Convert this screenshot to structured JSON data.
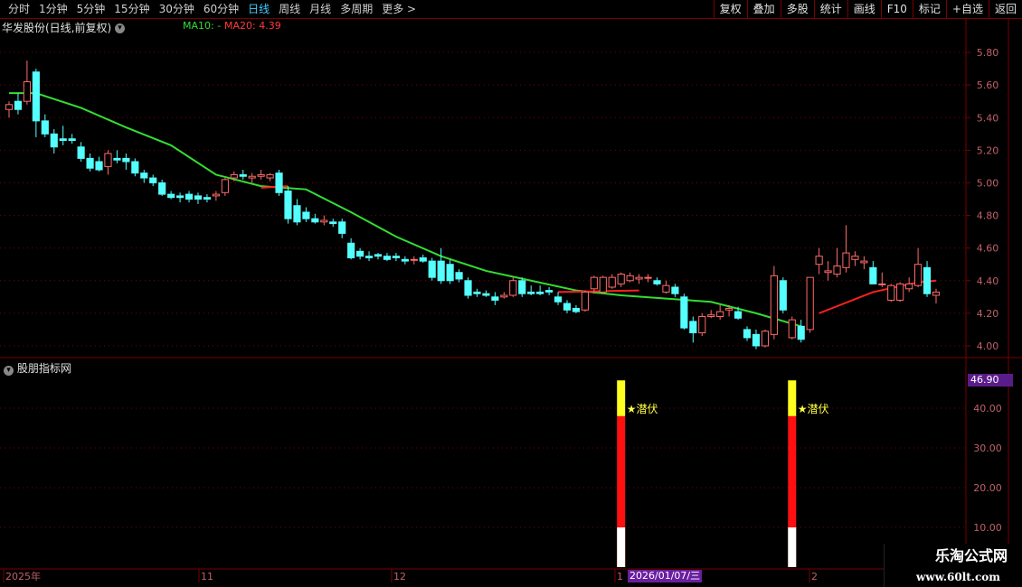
{
  "toolbar": {
    "periods": [
      "分时",
      "1分钟",
      "5分钟",
      "15分钟",
      "30分钟",
      "60分钟",
      "日线",
      "周线",
      "月线",
      "多周期",
      "更多 >"
    ],
    "active": "日线",
    "right_buttons": [
      "复权",
      "叠加",
      "多股",
      "统计",
      "画线",
      "F10",
      "标记",
      "+自选",
      "返回"
    ]
  },
  "chart_title": "华发股份(日线,前复权)",
  "ma_labels": {
    "ma10": "MA10: -",
    "ma20": "MA20: 4.39"
  },
  "price_axis": [
    "5.80",
    "5.60",
    "5.40",
    "5.20",
    "5.00",
    "4.80",
    "4.60",
    "4.40",
    "4.20",
    "4.00"
  ],
  "indicator_title": "股朋指标网",
  "indicator_axis": [
    "40.00",
    "30.00",
    "20.00",
    "10.00"
  ],
  "indicator_value": "46.90",
  "signal_label": "★潜伏",
  "time_axis": [
    "2025年",
    "11",
    "12",
    "1",
    "2"
  ],
  "cursor_date": "2026/01/07/三",
  "watermark": {
    "name": "乐淘公式网",
    "url": "www.60lt.com"
  },
  "colors": {
    "up": "#ff6a6a",
    "down": "#54ffff",
    "ma": "#33dd33",
    "ma_red": "#ff2020",
    "grid": "#7a0000"
  },
  "chart_data": {
    "type": "candlestick",
    "ylim": [
      3.95,
      5.9
    ],
    "candles": [
      [
        5.45,
        5.5,
        5.4,
        5.48
      ],
      [
        5.5,
        5.55,
        5.42,
        5.45
      ],
      [
        5.5,
        5.75,
        5.48,
        5.62
      ],
      [
        5.68,
        5.7,
        5.28,
        5.38
      ],
      [
        5.38,
        5.42,
        5.28,
        5.3
      ],
      [
        5.3,
        5.33,
        5.18,
        5.22
      ],
      [
        5.27,
        5.35,
        5.23,
        5.26
      ],
      [
        5.27,
        5.3,
        5.24,
        5.26
      ],
      [
        5.22,
        5.25,
        5.13,
        5.15
      ],
      [
        5.15,
        5.18,
        5.07,
        5.09
      ],
      [
        5.13,
        5.16,
        5.07,
        5.08
      ],
      [
        5.1,
        5.2,
        5.05,
        5.18
      ],
      [
        5.15,
        5.2,
        5.12,
        5.14
      ],
      [
        5.15,
        5.18,
        5.08,
        5.13
      ],
      [
        5.13,
        5.15,
        5.04,
        5.06
      ],
      [
        5.06,
        5.08,
        5.0,
        5.03
      ],
      [
        5.03,
        5.05,
        4.98,
        5.0
      ],
      [
        5.0,
        5.02,
        4.92,
        4.93
      ],
      [
        4.93,
        4.95,
        4.9,
        4.91
      ],
      [
        4.92,
        4.94,
        4.88,
        4.91
      ],
      [
        4.93,
        4.95,
        4.88,
        4.9
      ],
      [
        4.92,
        4.94,
        4.87,
        4.9
      ],
      [
        4.91,
        4.93,
        4.88,
        4.9
      ],
      [
        4.92,
        4.95,
        4.89,
        4.93
      ],
      [
        4.94,
        5.03,
        4.92,
        5.02
      ],
      [
        5.03,
        5.07,
        5.01,
        5.05
      ],
      [
        5.05,
        5.08,
        5.02,
        5.04
      ],
      [
        5.03,
        5.06,
        5.0,
        5.04
      ],
      [
        5.04,
        5.08,
        5.02,
        5.05
      ],
      [
        5.03,
        5.06,
        5.01,
        5.05
      ],
      [
        5.06,
        5.08,
        4.92,
        4.94
      ],
      [
        4.95,
        4.98,
        4.75,
        4.78
      ],
      [
        4.86,
        4.9,
        4.74,
        4.76
      ],
      [
        4.82,
        4.85,
        4.76,
        4.78
      ],
      [
        4.78,
        4.81,
        4.75,
        4.76
      ],
      [
        4.76,
        4.8,
        4.74,
        4.77
      ],
      [
        4.76,
        4.78,
        4.73,
        4.75
      ],
      [
        4.76,
        4.78,
        4.66,
        4.69
      ],
      [
        4.63,
        4.66,
        4.53,
        4.54
      ],
      [
        4.58,
        4.6,
        4.53,
        4.55
      ],
      [
        4.55,
        4.58,
        4.52,
        4.54
      ],
      [
        4.56,
        4.57,
        4.53,
        4.55
      ],
      [
        4.55,
        4.57,
        4.52,
        4.53
      ],
      [
        4.55,
        4.57,
        4.52,
        4.54
      ],
      [
        4.53,
        4.55,
        4.5,
        4.52
      ],
      [
        4.53,
        4.55,
        4.5,
        4.53
      ],
      [
        4.54,
        4.56,
        4.51,
        4.52
      ],
      [
        4.52,
        4.54,
        4.4,
        4.42
      ],
      [
        4.52,
        4.6,
        4.38,
        4.4
      ],
      [
        4.5,
        4.53,
        4.38,
        4.4
      ],
      [
        4.45,
        4.47,
        4.39,
        4.41
      ],
      [
        4.4,
        4.42,
        4.29,
        4.31
      ],
      [
        4.33,
        4.35,
        4.3,
        4.32
      ],
      [
        4.32,
        4.34,
        4.3,
        4.31
      ],
      [
        4.3,
        4.33,
        4.25,
        4.28
      ],
      [
        4.3,
        4.33,
        4.29,
        4.31
      ],
      [
        4.31,
        4.42,
        4.3,
        4.4
      ],
      [
        4.4,
        4.42,
        4.3,
        4.32
      ],
      [
        4.33,
        4.37,
        4.31,
        4.32
      ],
      [
        4.33,
        4.37,
        4.31,
        4.32
      ],
      [
        4.34,
        4.36,
        4.31,
        4.33
      ],
      [
        4.3,
        4.33,
        4.25,
        4.27
      ],
      [
        4.26,
        4.28,
        4.2,
        4.22
      ],
      [
        4.23,
        4.25,
        4.2,
        4.21
      ],
      [
        4.22,
        4.34,
        4.21,
        4.33
      ],
      [
        4.35,
        4.43,
        4.32,
        4.42
      ],
      [
        4.33,
        4.43,
        4.32,
        4.42
      ],
      [
        4.36,
        4.44,
        4.35,
        4.42
      ],
      [
        4.38,
        4.45,
        4.36,
        4.44
      ],
      [
        4.4,
        4.45,
        4.39,
        4.43
      ],
      [
        4.41,
        4.44,
        4.38,
        4.42
      ],
      [
        4.42,
        4.44,
        4.39,
        4.42
      ],
      [
        4.4,
        4.42,
        4.37,
        4.38
      ],
      [
        4.33,
        4.4,
        4.32,
        4.37
      ],
      [
        4.36,
        4.38,
        4.3,
        4.32
      ],
      [
        4.3,
        4.32,
        4.1,
        4.11
      ],
      [
        4.15,
        4.18,
        4.02,
        4.08
      ],
      [
        4.08,
        4.2,
        4.06,
        4.18
      ],
      [
        4.18,
        4.22,
        4.17,
        4.19
      ],
      [
        4.18,
        4.25,
        4.16,
        4.21
      ],
      [
        4.22,
        4.25,
        4.18,
        4.23
      ],
      [
        4.21,
        4.24,
        4.16,
        4.17
      ],
      [
        4.1,
        4.12,
        4.03,
        4.05
      ],
      [
        4.07,
        4.1,
        3.98,
        4.0
      ],
      [
        4.0,
        4.1,
        3.99,
        4.09
      ],
      [
        4.07,
        4.49,
        4.04,
        4.43
      ],
      [
        4.4,
        4.42,
        4.2,
        4.22
      ],
      [
        4.05,
        4.18,
        4.04,
        4.16
      ],
      [
        4.12,
        4.16,
        4.02,
        4.04
      ],
      [
        4.1,
        4.42,
        4.08,
        4.42
      ],
      [
        4.5,
        4.6,
        4.44,
        4.55
      ],
      [
        4.45,
        4.52,
        4.4,
        4.46
      ],
      [
        4.44,
        4.6,
        4.42,
        4.49
      ],
      [
        4.48,
        4.74,
        4.45,
        4.57
      ],
      [
        4.53,
        4.58,
        4.49,
        4.55
      ],
      [
        4.51,
        4.55,
        4.47,
        4.52
      ],
      [
        4.48,
        4.52,
        4.4,
        4.38
      ],
      [
        4.38,
        4.45,
        4.36,
        4.38
      ],
      [
        4.28,
        4.38,
        4.27,
        4.37
      ],
      [
        4.28,
        4.39,
        4.27,
        4.38
      ],
      [
        4.35,
        4.42,
        4.33,
        4.38
      ],
      [
        4.37,
        4.6,
        4.36,
        4.5
      ],
      [
        4.48,
        4.52,
        4.3,
        4.32
      ],
      [
        4.31,
        4.35,
        4.26,
        4.33
      ]
    ],
    "ma_green": [
      [
        0,
        5.55
      ],
      [
        3,
        5.55
      ],
      [
        8,
        5.46
      ],
      [
        13,
        5.34
      ],
      [
        18,
        5.23
      ],
      [
        23,
        5.05
      ],
      [
        28,
        4.98
      ],
      [
        33,
        4.96
      ],
      [
        38,
        4.82
      ],
      [
        43,
        4.67
      ],
      [
        48,
        4.55
      ],
      [
        53,
        4.46
      ],
      [
        58,
        4.4
      ],
      [
        63,
        4.34
      ],
      [
        68,
        4.31
      ],
      [
        73,
        4.29
      ],
      [
        78,
        4.27
      ],
      [
        83,
        4.2
      ],
      [
        88,
        4.12
      ]
    ],
    "ma_red_segments": [
      [
        [
          28,
          4.97
        ],
        [
          31,
          4.98
        ]
      ],
      [
        [
          61,
          4.33
        ],
        [
          70,
          4.34
        ]
      ],
      [
        [
          90,
          4.2
        ],
        [
          96,
          4.33
        ],
        [
          101,
          4.39
        ],
        [
          103,
          4.4
        ]
      ]
    ],
    "signals": [
      {
        "index": 68,
        "white": 10,
        "red": 38,
        "yellow": 47,
        "label": "★潜伏"
      },
      {
        "index": 87,
        "white": 10,
        "red": 38,
        "yellow": 47,
        "label": "★潜伏"
      }
    ],
    "indicator_ylim": [
      0,
      50
    ]
  }
}
